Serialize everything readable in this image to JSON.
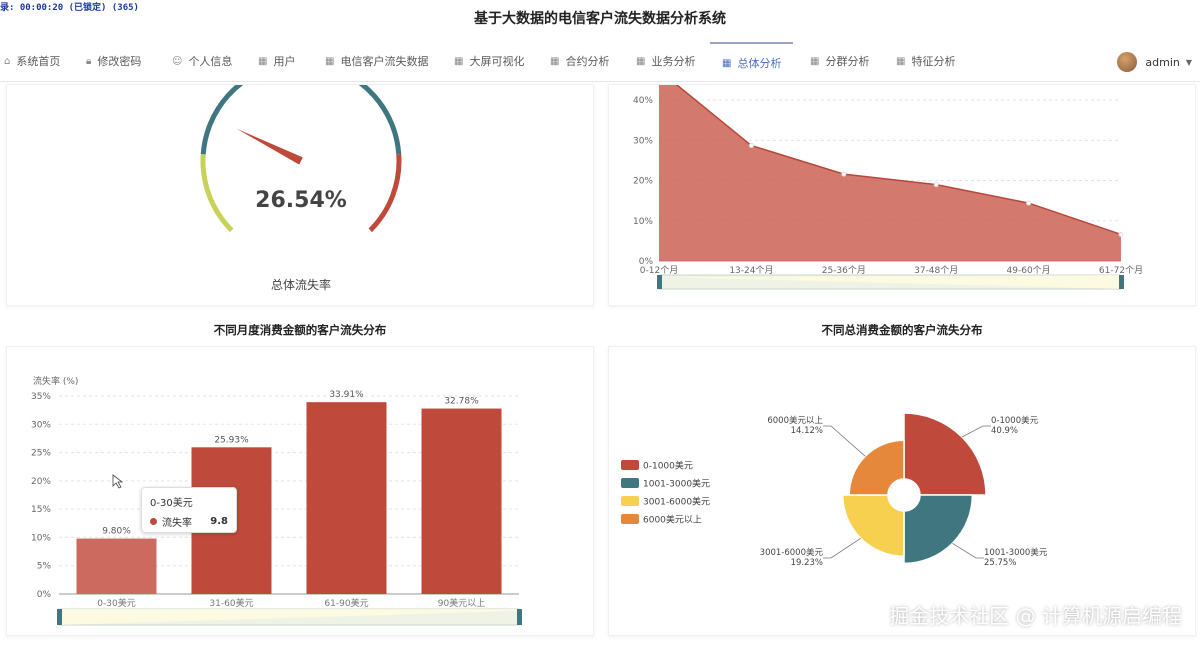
{
  "overlay": {
    "rec_text": "录: 00:00:20 (已锁定) (365)"
  },
  "app": {
    "title": "基于大数据的电信客户流失数据分析系统"
  },
  "nav": {
    "items": [
      {
        "label": "系统首页",
        "icon": "home-icon"
      },
      {
        "label": "修改密码",
        "icon": "lock-icon"
      },
      {
        "label": "个人信息",
        "icon": "user-icon"
      },
      {
        "label": "用户",
        "icon": "grid-icon"
      },
      {
        "label": "电信客户流失数据",
        "icon": "grid-icon"
      },
      {
        "label": "大屏可视化",
        "icon": "grid-icon"
      },
      {
        "label": "合约分析",
        "icon": "grid-icon"
      },
      {
        "label": "业务分析",
        "icon": "grid-icon"
      },
      {
        "label": "总体分析",
        "icon": "grid-icon",
        "active": true
      },
      {
        "label": "分群分析",
        "icon": "grid-icon"
      },
      {
        "label": "特征分析",
        "icon": "grid-icon"
      }
    ],
    "user": "admin"
  },
  "gauge": {
    "value_text": "26.54%",
    "label": "总体流失率",
    "colors": {
      "low": "#c8d25a",
      "mid": "#3f7680",
      "high": "#bf4a3b"
    }
  },
  "tenure_chart": {
    "chart_data": {
      "type": "area",
      "categories": [
        "0-12个月",
        "13-24个月",
        "25-36个月",
        "37-48个月",
        "49-60个月",
        "61-72个月"
      ],
      "values": [
        47.4,
        28.7,
        21.6,
        19.0,
        14.4,
        6.6
      ],
      "yticks": [
        "0%",
        "10%",
        "20%",
        "30%",
        "40%"
      ],
      "ylim": [
        0,
        45
      ],
      "color": "#c9574a",
      "grid": true
    }
  },
  "monthly_chart": {
    "title": "不同月度消费金额的客户流失分布",
    "chart_data": {
      "type": "bar",
      "ylabel": "流失率 (%)",
      "categories": [
        "0-30美元",
        "31-60美元",
        "61-90美元",
        "90美元以上"
      ],
      "values": [
        9.8,
        25.93,
        33.91,
        32.78
      ],
      "labels": [
        "9.80%",
        "25.93%",
        "33.91%",
        "32.78%"
      ],
      "yticks": [
        "0%",
        "5%",
        "10%",
        "15%",
        "20%",
        "25%",
        "30%",
        "35%"
      ],
      "ylim": [
        0,
        35
      ],
      "color": "#bf4a3b",
      "highlight_color": "#cc6a5f",
      "grid": true
    },
    "tooltip": {
      "title": "0-30美元",
      "series": "流失率",
      "value": "9.8"
    }
  },
  "total_chart": {
    "title": "不同总消费金额的客户流失分布",
    "chart_data": {
      "type": "pie",
      "slices": [
        {
          "name": "0-1000美元",
          "value": 40.9,
          "label": "40.9%",
          "color": "#bf4a3b"
        },
        {
          "name": "1001-3000美元",
          "value": 25.75,
          "label": "25.75%",
          "color": "#3f7680"
        },
        {
          "name": "3001-6000美元",
          "value": 19.23,
          "label": "19.23%",
          "color": "#f7d04f"
        },
        {
          "name": "6000美元以上",
          "value": 14.12,
          "label": "14.12%",
          "color": "#e6883b"
        }
      ],
      "legend": "left"
    }
  },
  "watermark": "掘金技术社区 @ 计算机源启编程"
}
